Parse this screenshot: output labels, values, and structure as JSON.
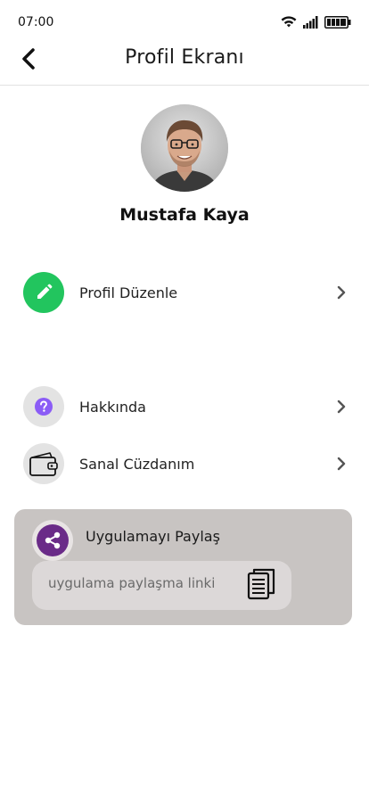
{
  "status_bar": {
    "time": "07:00"
  },
  "header": {
    "title": "Profil Ekranı"
  },
  "profile": {
    "name": "Mustafa Kaya"
  },
  "menu": [
    {
      "label": "Profil Düzenle",
      "icon": "pencil-icon",
      "icon_bg": "#22c55e"
    },
    {
      "label": "Hakkında",
      "icon": "question-icon",
      "icon_bg": "#e3e3e3"
    },
    {
      "label": "Sanal Cüzdanım",
      "icon": "wallet-icon",
      "icon_bg": "#e3e3e3"
    }
  ],
  "share": {
    "title": "Uygulamayı Paylaş",
    "link_placeholder": "uygulama paylaşma linki",
    "icon": "share-icon",
    "copy_icon": "copy-icon"
  },
  "colors": {
    "edit_green": "#22c55e",
    "question_purple": "#8b5cf6",
    "share_purple": "#6a2b88",
    "card_bg": "#c8c4c2"
  }
}
